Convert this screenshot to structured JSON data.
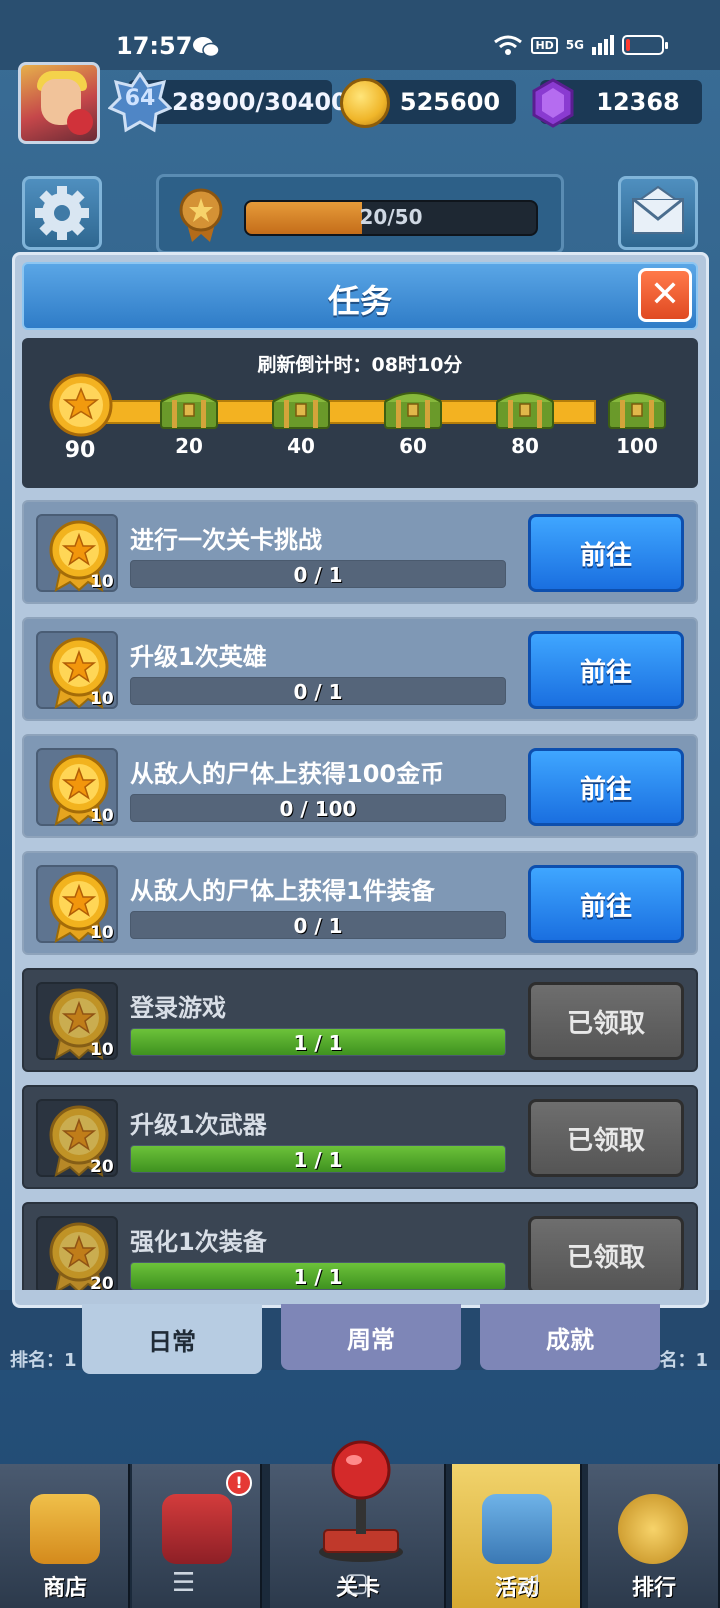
{
  "status": {
    "time": "17:57",
    "hd": "HD",
    "network": "5G",
    "battery_level": 0.12
  },
  "player": {
    "level": "64",
    "xp": "28900/30400",
    "coins": "525600",
    "gems": "12368"
  },
  "season": {
    "progress": "20/50",
    "progress_fraction": 0.4
  },
  "modal": {
    "title": "任务",
    "refresh": "刷新倒计时：08时10分",
    "activity_score": "90",
    "milestones": [
      "20",
      "40",
      "60",
      "80",
      "100"
    ]
  },
  "tasks": [
    {
      "title": "进行一次关卡挑战",
      "reward": "10",
      "progress": "0 / 1",
      "fraction": 0,
      "button": "前往",
      "state": "go"
    },
    {
      "title": "升级1次英雄",
      "reward": "10",
      "progress": "0 / 1",
      "fraction": 0,
      "button": "前往",
      "state": "go"
    },
    {
      "title": "从敌人的尸体上获得100金币",
      "reward": "10",
      "progress": "0 / 100",
      "fraction": 0,
      "button": "前往",
      "state": "go"
    },
    {
      "title": "从敌人的尸体上获得1件装备",
      "reward": "10",
      "progress": "0 / 1",
      "fraction": 0,
      "button": "前往",
      "state": "go"
    },
    {
      "title": "登录游戏",
      "reward": "10",
      "progress": "1 / 1",
      "fraction": 1,
      "button": "已领取",
      "state": "claimed"
    },
    {
      "title": "升级1次武器",
      "reward": "20",
      "progress": "1 / 1",
      "fraction": 1,
      "button": "已领取",
      "state": "claimed"
    },
    {
      "title": "强化1次装备",
      "reward": "20",
      "progress": "1 / 1",
      "fraction": 1,
      "button": "已领取",
      "state": "claimed"
    }
  ],
  "tabs": [
    "日常",
    "周常",
    "成就"
  ],
  "background": {
    "rank_left": "排名：1",
    "rank_right": "名：1"
  },
  "nav": {
    "items": [
      "商店",
      "",
      "关卡",
      "活动",
      "排行"
    ],
    "badge": "!"
  },
  "icons": {
    "settings": "gear-icon",
    "mail": "mail-icon",
    "close": "close-icon",
    "coin": "coin-icon",
    "gem": "gem-icon",
    "medal": "star-medal-icon",
    "chest": "chest-icon"
  },
  "colors": {
    "go_button": "#1a6fe0",
    "claimed_button": "#555555",
    "progress_green": "#3f9220",
    "track_gold": "#f3b221"
  }
}
